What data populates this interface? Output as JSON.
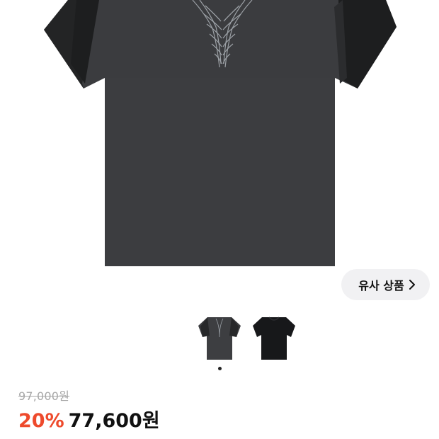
{
  "product": {
    "image_alt": "dark gray t-shirt with embroidered back graphic",
    "colors": {
      "shirt_main": "#3b3c3f",
      "shirt_panel": "#1e1f20",
      "stitch": "#b8bcc2"
    }
  },
  "similar_button": {
    "label": "유사 상품",
    "icon": "chevron-right-icon"
  },
  "thumbnails": [
    {
      "name": "gray-tshirt",
      "color": "#3d3e41"
    },
    {
      "name": "black-tshirt",
      "color": "#17181a"
    }
  ],
  "pagination": {
    "active_index": 0,
    "count": 1
  },
  "price": {
    "original": "97,000원",
    "discount": "20%",
    "sale": "77,600원",
    "discount_color": "#ee4a2c"
  }
}
